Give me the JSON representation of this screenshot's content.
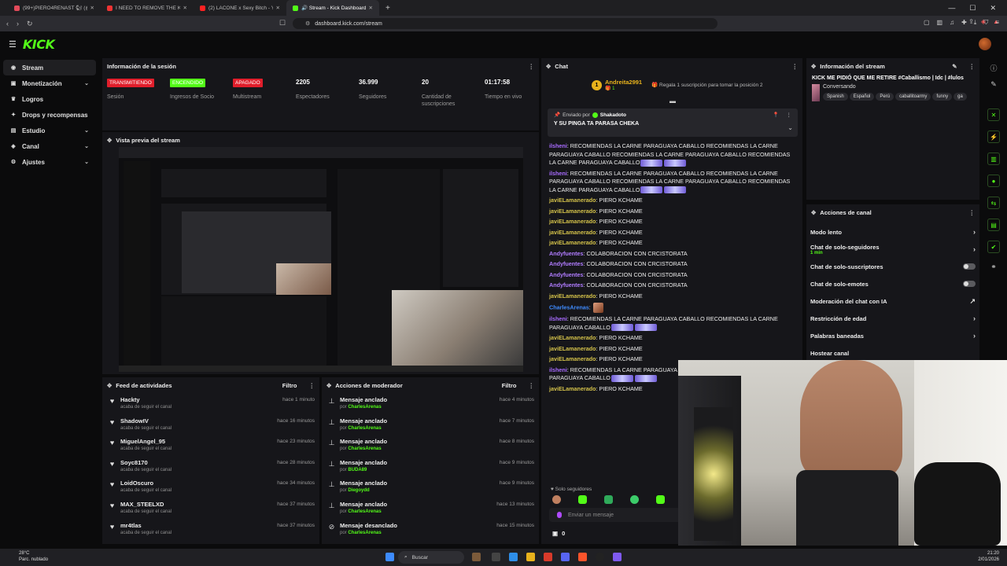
{
  "browser": {
    "tabs": [
      {
        "label": "(99+)PIERO4RENAST 🐿 (@piemans",
        "color": "#e24a5a"
      },
      {
        "label": "I NEED TO REMOVE THE KICK LIMIT",
        "color": "#e33"
      },
      {
        "label": "(2) LACONE x Sexy Bitch - YouTu",
        "color": "#f22"
      },
      {
        "label": "🔊 Stream - Kick Dashboard",
        "color": "#53fc18",
        "active": true
      }
    ],
    "url": "dashboard.kick.com/stream"
  },
  "header": {
    "logo": "KICK"
  },
  "sidebar": {
    "items": [
      {
        "label": "Stream",
        "icon": "broadcast-icon",
        "glyph": "◉",
        "active": true,
        "chevron": false
      },
      {
        "label": "Monetización",
        "icon": "money-icon",
        "glyph": "▣",
        "chevron": true
      },
      {
        "label": "Logros",
        "icon": "trophy-icon",
        "glyph": "♛",
        "chevron": false
      },
      {
        "label": "Drops y recompensas",
        "icon": "gift-icon",
        "glyph": "✦",
        "chevron": false
      },
      {
        "label": "Estudio",
        "icon": "studio-icon",
        "glyph": "▤",
        "chevron": true
      },
      {
        "label": "Canal",
        "icon": "channel-icon",
        "glyph": "◈",
        "chevron": true
      },
      {
        "label": "Ajustes",
        "icon": "gear-icon",
        "glyph": "⚙",
        "chevron": true
      }
    ]
  },
  "session": {
    "title": "Información de la sesión",
    "stats": [
      {
        "value": "TRANSMITIENDO",
        "label": "Sesión",
        "kind": "badge-red"
      },
      {
        "value": "ENCENDIDO",
        "label": "Ingresos de Socio",
        "kind": "badge-green"
      },
      {
        "value": "APAGADO",
        "label": "Multistream",
        "kind": "badge-red"
      },
      {
        "value": "2205",
        "label": "Espectadores",
        "kind": "number"
      },
      {
        "value": "36.999",
        "label": "Seguidores",
        "kind": "number"
      },
      {
        "value": "20",
        "label": "Cantidad de suscripciones",
        "kind": "number"
      },
      {
        "value": "01:17:58",
        "label": "Tiempo en vivo",
        "kind": "number"
      }
    ]
  },
  "preview": {
    "title": "Vista previa del stream"
  },
  "activity": {
    "title": "Feed de actividades",
    "filter": "Filtro",
    "items": [
      {
        "name": "Hackty",
        "sub": "acaba de seguir el canal",
        "time": "hace 1 minuto"
      },
      {
        "name": "ShadowIV",
        "sub": "acaba de seguir el canal",
        "time": "hace 16 minutos"
      },
      {
        "name": "MiguelAngel_95",
        "sub": "acaba de seguir el canal",
        "time": "hace 23 minutos"
      },
      {
        "name": "Soyc8170",
        "sub": "acaba de seguir el canal",
        "time": "hace 28 minutos"
      },
      {
        "name": "LoidOscuro",
        "sub": "acaba de seguir el canal",
        "time": "hace 34 minutos"
      },
      {
        "name": "MAX_STEELXD",
        "sub": "acaba de seguir el canal",
        "time": "hace 37 minutos"
      },
      {
        "name": "mr4tlas",
        "sub": "acaba de seguir el canal",
        "time": "hace 37 minutos"
      }
    ]
  },
  "mod": {
    "title": "Acciones de moderador",
    "filter": "Filtro",
    "by": "por",
    "items": [
      {
        "action": "Mensaje anclado",
        "by": "CharlesArenas",
        "time": "hace 4 minutos"
      },
      {
        "action": "Mensaje anclado",
        "by": "CharlesArenas",
        "time": "hace 7 minutos"
      },
      {
        "action": "Mensaje anclado",
        "by": "CharlesArenas",
        "time": "hace 8 minutos"
      },
      {
        "action": "Mensaje anclado",
        "by": "BUDA89",
        "time": "hace 9 minutos"
      },
      {
        "action": "Mensaje anclado",
        "by": "Diegoydd",
        "time": "hace 9 minutos"
      },
      {
        "action": "Mensaje anclado",
        "by": "CharlesArenas",
        "time": "hace 13 minutos"
      },
      {
        "action": "Mensaje desanclado",
        "by": "CharlesArenas",
        "time": "hace 15 minutos"
      }
    ]
  },
  "chat": {
    "title": "Chat",
    "gift_user": "Andreita2991",
    "gift_count": "1",
    "gift_text": "Regala 1 suscripción para tomar la posición 2",
    "pinned_by_label": "Enviado por",
    "pinned_by": "Shakadoto",
    "pinned_text": "Y SU PINGA TA PARASA CHEKA",
    "messages": [
      {
        "user": "ilsheni",
        "color": "#a86bff",
        "text": "RECOMIENDAS LA CARNE PARAGUAYA CABALLO RECOMIENDAS LA CARNE PARAGUAYA CABALLO RECOMIENDAS LA CARNE PARAGUAYA CABALLO RECOMIENDAS LA CARNE PARAGUAYA CABALLO"
      },
      {
        "user": "ilsheni",
        "color": "#a86bff",
        "text": "RECOMIENDAS LA CARNE PARAGUAYA CABALLO RECOMIENDAS LA CARNE PARAGUAYA CABALLO RECOMIENDAS LA CARNE PARAGUAYA CABALLO RECOMIENDAS LA CARNE PARAGUAYA CABALLO"
      },
      {
        "user": "javiELamanerado",
        "color": "#d4c24a",
        "text": "PIERO KCHAME"
      },
      {
        "user": "javiELamanerado",
        "color": "#d4c24a",
        "text": "PIERO KCHAME"
      },
      {
        "user": "javiELamanerado",
        "color": "#d4c24a",
        "text": "PIERO KCHAME"
      },
      {
        "user": "javiELamanerado",
        "color": "#d4c24a",
        "text": "PIERO KCHAME"
      },
      {
        "user": "javiELamanerado",
        "color": "#d4c24a",
        "text": "PIERO KCHAME"
      },
      {
        "user": "Andyfuentes",
        "color": "#b07cff",
        "text": "COLABORACION CON CRCISTORATA"
      },
      {
        "user": "Andyfuentes",
        "color": "#b07cff",
        "text": "COLABORACION CON CRCISTORATA"
      },
      {
        "user": "Andyfuentes",
        "color": "#b07cff",
        "text": "COLABORACION CON CRCISTORATA"
      },
      {
        "user": "Andyfuentes",
        "color": "#b07cff",
        "text": "COLABORACION CON CRCISTORATA"
      },
      {
        "user": "javiELamanerado",
        "color": "#d4c24a",
        "text": "PIERO KCHAME"
      },
      {
        "user": "CharlesArenas",
        "color": "#3f8cff",
        "text": ""
      },
      {
        "user": "ilsheni",
        "color": "#a86bff",
        "text": "RECOMIENDAS LA CARNE PARAGUAYA CABALLO RECOMIENDAS LA CARNE PARAGUAYA CABALLO"
      },
      {
        "user": "javiELamanerado",
        "color": "#d4c24a",
        "text": "PIERO KCHAME"
      },
      {
        "user": "javiELamanerado",
        "color": "#d4c24a",
        "text": "PIERO KCHAME"
      },
      {
        "user": "javiELamanerado",
        "color": "#d4c24a",
        "text": "PIERO KCHAME"
      },
      {
        "user": "ilsheni",
        "color": "#a86bff",
        "text": "RECOMIENDAS LA CARNE PARAGUAYA CABALLO RECOMIENDAS LA CARNE PARAGUAYA CABALLO"
      },
      {
        "user": "javiELamanerado",
        "color": "#d4c24a",
        "text": "PIERO KCHAME"
      }
    ],
    "followers_only": "Solo seguidores",
    "input_placeholder": "Enviar un mensaje",
    "kicks": "0"
  },
  "stream_info": {
    "title": "Información del stream",
    "stream_title": "KICK ME PIDIÓ QUE ME RETIRE #Caballismo | Idc | #lulos",
    "category": "Conversando",
    "tags": [
      "Spanish",
      "Español",
      "Perú",
      "caballitoarmy",
      "funny",
      "ga"
    ]
  },
  "channel_actions": {
    "title": "Acciones de canal",
    "items": [
      {
        "label": "Modo lento",
        "control": "chevron"
      },
      {
        "label": "Chat de solo-seguidores",
        "sub": "1 min",
        "control": "chevron"
      },
      {
        "label": "Chat de solo-suscriptores",
        "control": "toggle"
      },
      {
        "label": "Chat de solo-emotes",
        "control": "toggle"
      },
      {
        "label": "Moderación del chat con IA",
        "control": "external"
      },
      {
        "label": "Restricción de edad",
        "control": "chevron"
      },
      {
        "label": "Palabras baneadas",
        "control": "chevron"
      },
      {
        "label": "Hostear canal",
        "control": "none"
      }
    ]
  },
  "taskbar": {
    "weather_temp": "28°C",
    "weather_desc": "Parc. nublado",
    "search": "Buscar",
    "time": "21:20",
    "date": "2/01/2026"
  },
  "colors": {
    "accent": "#53fc18",
    "live_red": "#e01e2b",
    "panel": "#16161a",
    "background": "#0b0b0c"
  }
}
